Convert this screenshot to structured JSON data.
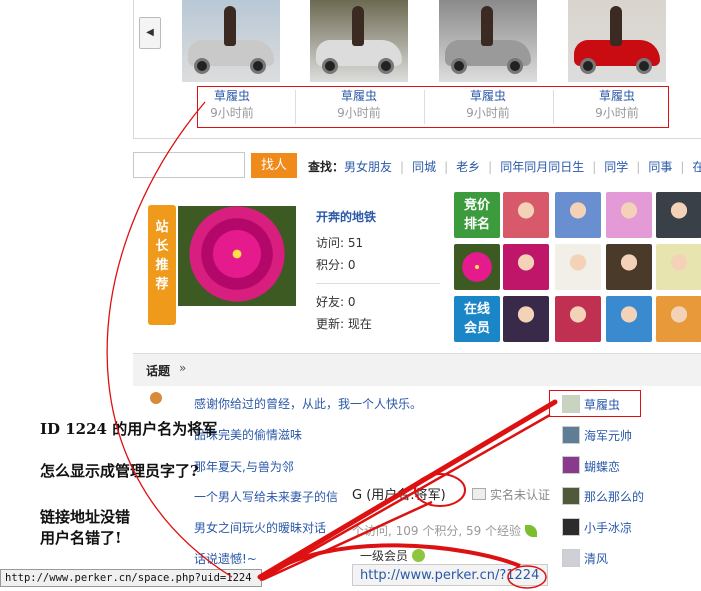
{
  "carousel": {
    "prev_icon": "chevron-left-icon",
    "items": [
      {
        "user": "草履虫",
        "time": "9小时前",
        "paint": "#b8c8d6",
        "car": "#c9c9c9"
      },
      {
        "user": "草履虫",
        "time": "9小时前",
        "paint": "#6d6a52",
        "car": "#dcdcdc"
      },
      {
        "user": "草履虫",
        "time": "9小时前",
        "paint": "#8a8a8a",
        "car": "#9a9a9a"
      },
      {
        "user": "草履虫",
        "time": "9小时前",
        "paint": "#d9d4cc",
        "car": "#c80c12"
      }
    ]
  },
  "search": {
    "button": "找人",
    "label": "查找：",
    "links": [
      "男女朋友",
      "同城",
      "老乡",
      "同年同月同日生",
      "同学",
      "同事",
      "在线"
    ]
  },
  "featured": {
    "ribbon": [
      "站",
      "长",
      "推",
      "荐"
    ],
    "name": "开奔的地铁",
    "visits": "访问: 51",
    "points": "积分: 0",
    "friends": "好友: 0",
    "updated": "更新: 现在",
    "auction_badge": [
      "竞价",
      "排名"
    ],
    "online_badge": [
      "在线",
      "会员"
    ]
  },
  "topics": {
    "title": "话题",
    "arrow": "»",
    "items": [
      "感谢你给过的曾经，从此，我一个人快乐。",
      "品味完美的偷情滋味",
      "那年夏天,与兽为邻",
      "一个男人写给未来妻子的信",
      "男女之间玩火的暧昧对话",
      "话说遗憾!~"
    ]
  },
  "users": [
    "草履虫",
    "海军元帅",
    "蝴蝶恋",
    "那么那么的",
    "小手冰凉",
    "清风"
  ],
  "popup": {
    "name": "G (用户名:将军)",
    "realname": "实名未认证",
    "stats": "个访问, 109 个积分, 59 个经验",
    "level": "一级会员",
    "url": "http://www.perker.cn/?1224"
  },
  "annotations": [
    "ID 1224 的用户名为将军",
    "怎么显示成管理员字了?",
    "链接地址没错",
    "用户名错了!"
  ],
  "status_bar": "http://www.perker.cn/space.php?uid=1224",
  "colors": {
    "link": "#2b58a8",
    "accent": "#f08a1a",
    "annotation": "#d11111"
  }
}
